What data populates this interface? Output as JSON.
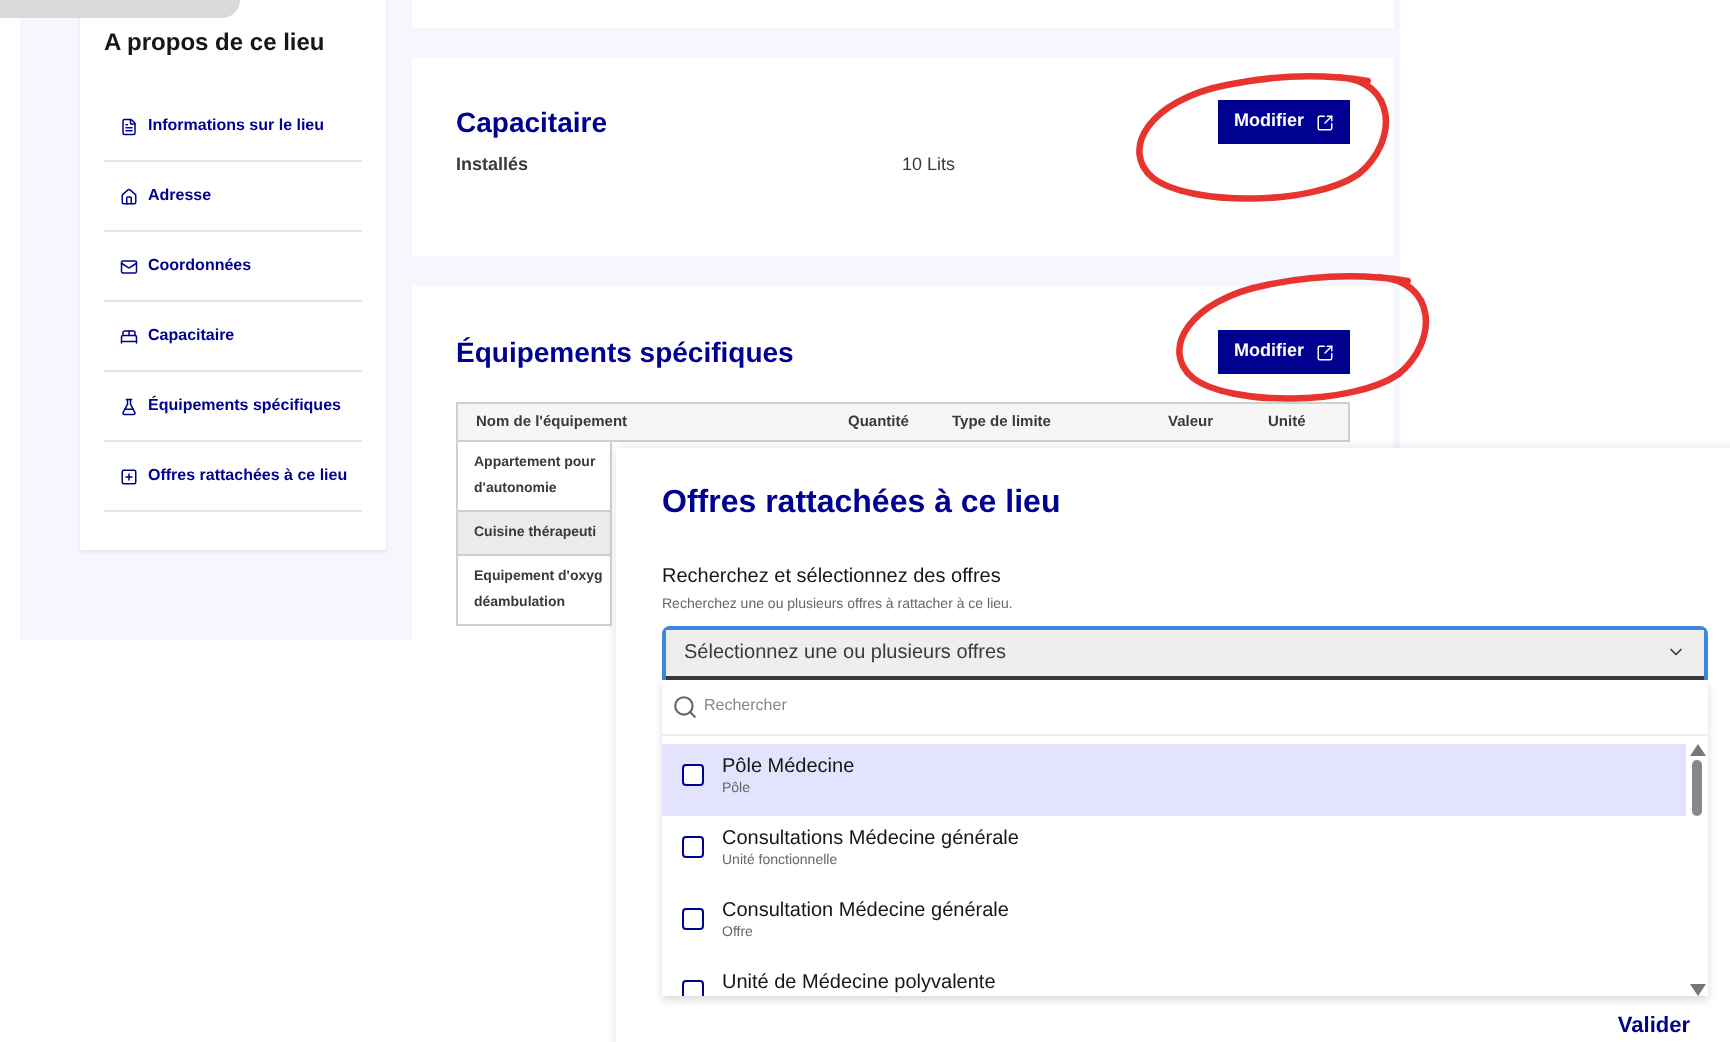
{
  "sidebar": {
    "title": "A propos de ce lieu",
    "items": [
      {
        "label": "Informations sur le lieu",
        "kind": "info"
      },
      {
        "label": "Adresse",
        "kind": "address"
      },
      {
        "label": "Coordonnées",
        "kind": "contact"
      },
      {
        "label": "Capacitaire",
        "kind": "capacity"
      },
      {
        "label": "Équipements spécifiques",
        "kind": "equipment"
      },
      {
        "label": "Offres rattachées à ce lieu",
        "kind": "offers"
      }
    ]
  },
  "capacity_card": {
    "title": "Capacitaire",
    "button": "Modifier",
    "rows": [
      {
        "label": "Installés",
        "value": "10 Lits"
      }
    ]
  },
  "equipment_card": {
    "title": "Équipements spécifiques",
    "button": "Modifier",
    "table": {
      "columns": [
        "Nom de l'équipement",
        "Quantité",
        "Type de limite",
        "Valeur",
        "Unité"
      ],
      "rows": [
        {
          "column_1": "Appartement pour d'autonomie",
          "shaded": false
        },
        {
          "column_1": "Cuisine thérapeuti",
          "shaded": true
        },
        {
          "column_1": "Equipement d'oxyg déambulation",
          "shaded": false
        }
      ]
    }
  },
  "dialog": {
    "title": "Offres rattachées à ce lieu",
    "label": "Recherchez et sélectionnez des offres",
    "hint": "Recherchez une ou plusieurs offres à rattacher à ce lieu.",
    "select": {
      "placeholder": "Sélectionnez une ou plusieurs offres"
    },
    "search": {
      "placeholder": "Rechercher"
    },
    "options": [
      {
        "name": "Pôle Médecine",
        "type": "Pôle",
        "selected": true,
        "checked": false
      },
      {
        "name": "Consultations Médecine générale",
        "type": "Unité fonctionnelle",
        "selected": false,
        "checked": false
      },
      {
        "name": "Consultation Médecine générale",
        "type": "Offre",
        "selected": false,
        "checked": false
      },
      {
        "name": "Unité de Médecine polyvalente",
        "selected": false,
        "checked": false
      }
    ],
    "confirm_button": "Valider"
  }
}
